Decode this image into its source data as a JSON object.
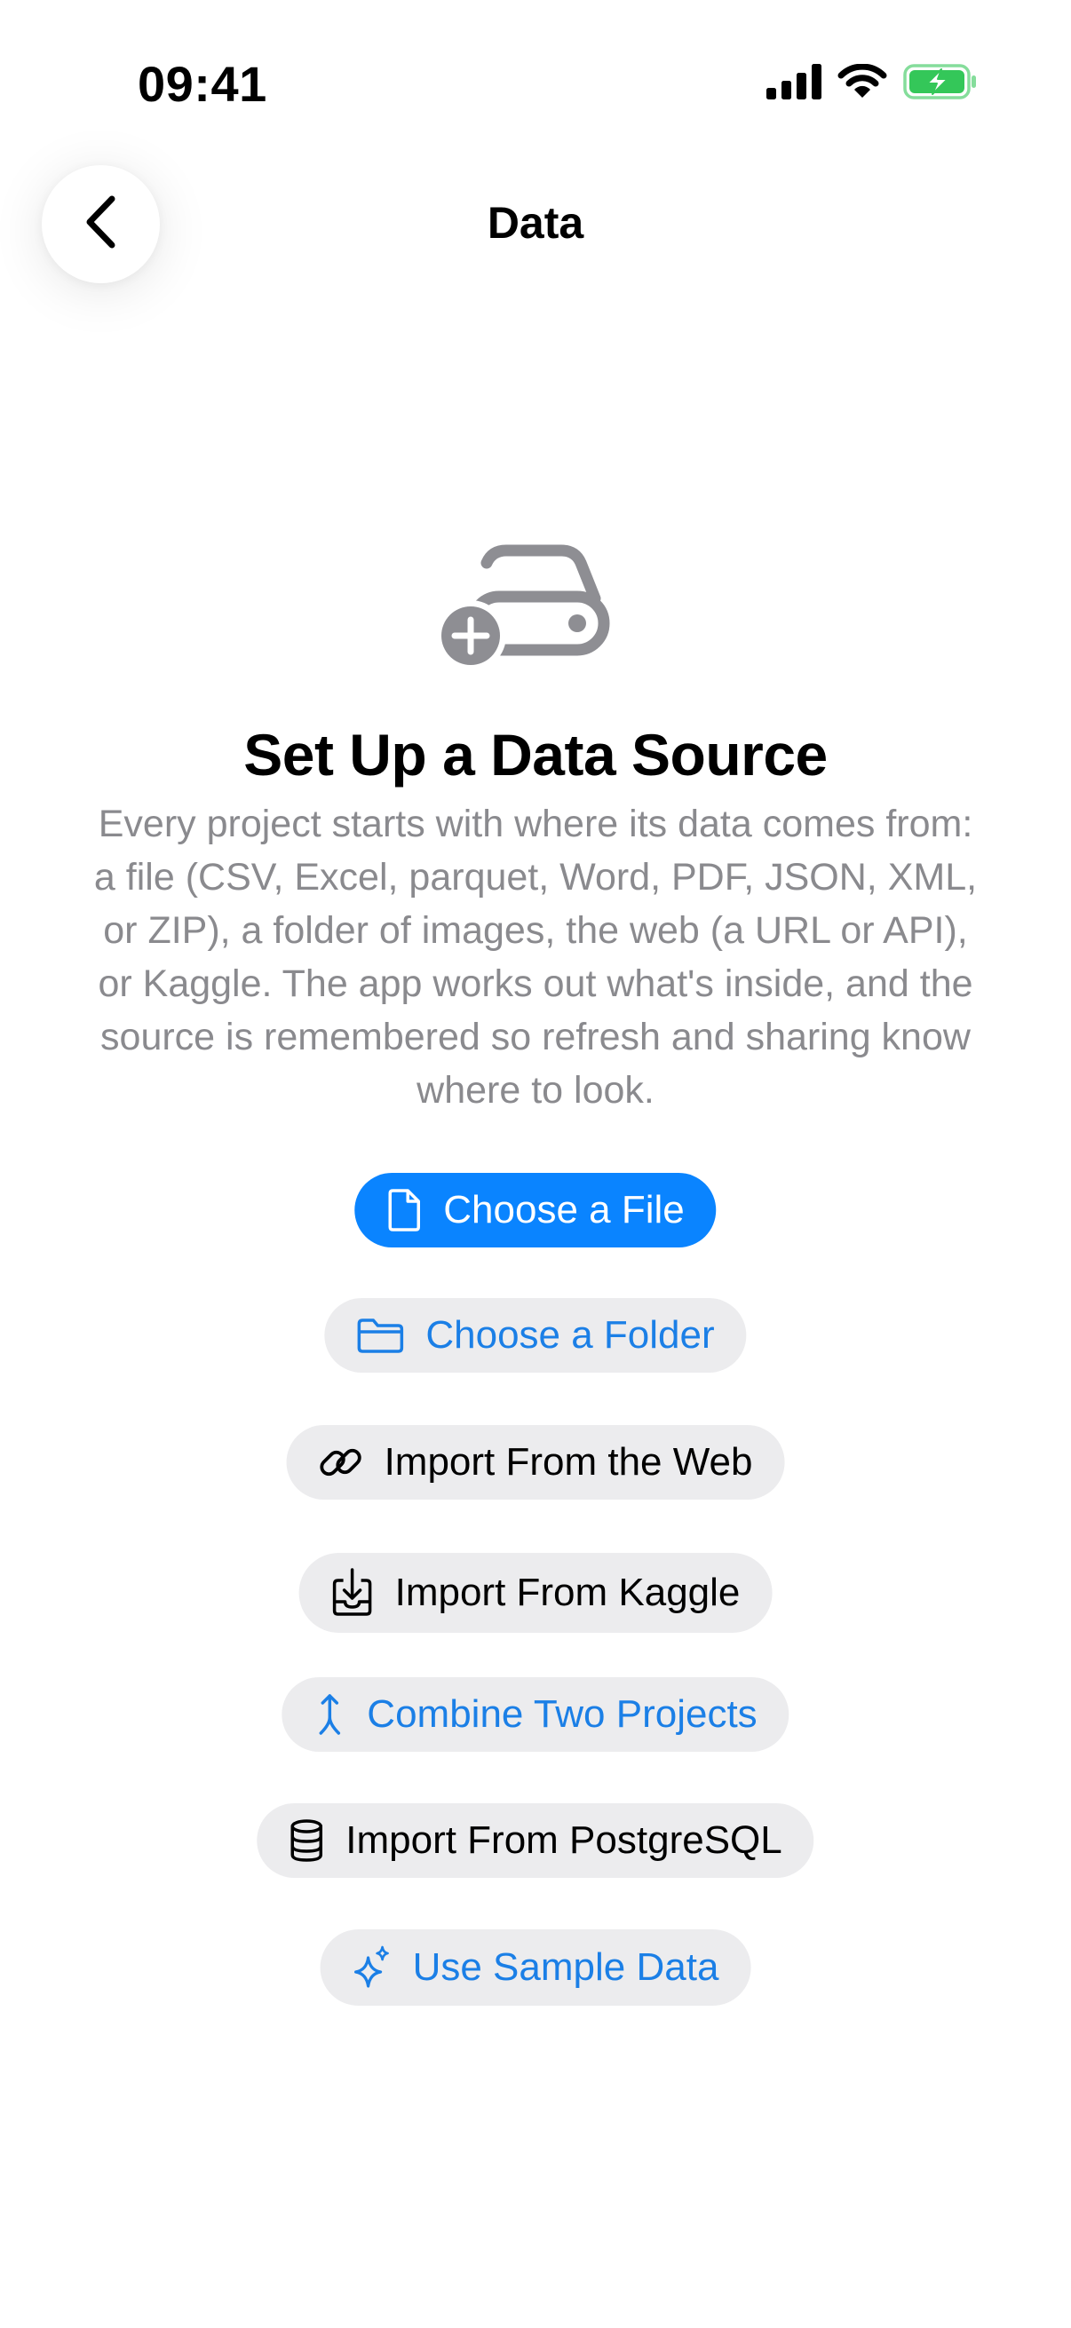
{
  "status_bar": {
    "time": "09:41",
    "icons": [
      "cellular-signal-icon",
      "wifi-icon",
      "battery-charging-icon"
    ]
  },
  "nav": {
    "title": "Data",
    "back_icon": "chevron-left-icon"
  },
  "empty_state": {
    "icon": "external-drive-badge-plus-icon",
    "headline": "Set Up a Data Source",
    "description": "Every project starts with where its data comes from: a file (CSV, Excel, parquet, Word, PDF, JSON, XML, or ZIP), a folder of images, the web (a URL or API), or Kaggle. The app works out what's inside, and the source is remembered so refresh and sharing know where to look."
  },
  "actions": [
    {
      "label": "Choose a File",
      "icon": "doc-icon",
      "style": "primary"
    },
    {
      "label": "Choose a Folder",
      "icon": "folder-icon",
      "style": "tint"
    },
    {
      "label": "Import From the Web",
      "icon": "link-icon",
      "style": "dark"
    },
    {
      "label": "Import From Kaggle",
      "icon": "tray-download-icon",
      "style": "dark"
    },
    {
      "label": "Combine Two Projects",
      "icon": "merge-arrow-icon",
      "style": "tint"
    },
    {
      "label": "Import From PostgreSQL",
      "icon": "cylinder-database-icon",
      "style": "dark"
    },
    {
      "label": "Use Sample Data",
      "icon": "sparkles-icon",
      "style": "tint"
    }
  ],
  "colors": {
    "accent": "#0a84ff",
    "tint_text": "#1b7fe6",
    "secondary_text": "#8a8a8e",
    "button_fill": "#ececee",
    "battery_green": "#34c759"
  }
}
